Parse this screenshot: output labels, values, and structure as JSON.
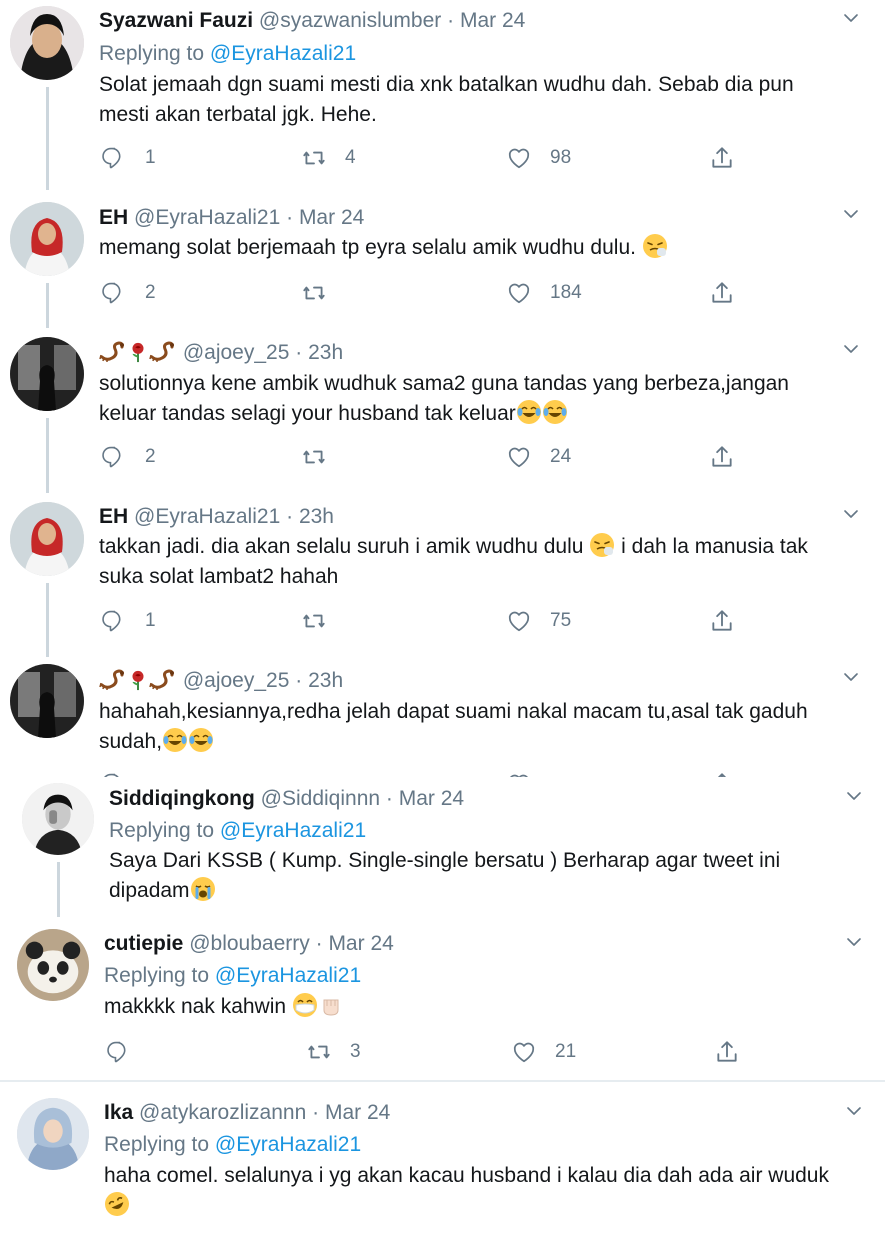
{
  "tweets": [
    {
      "name": "Syazwani Fauzi",
      "handle": "@syazwanislumber",
      "sep": "·",
      "time": "Mar 24",
      "replying_prefix": "Replying to",
      "replying_mention": "@EyraHazali21",
      "line1": "Solat jemaah dgn suami mesti dia xnk batalkan wudhu dah. Sebab dia pun",
      "line2": "mesti akan terbatal jgk. Hehe.",
      "reply_count": "1",
      "retweet_count": "4",
      "like_count": "98"
    },
    {
      "name": "EH",
      "handle": "@EyraHazali21",
      "sep": "·",
      "time": "Mar 24",
      "line1": "memang solat berjemaah tp eyra selalu amik wudhu dulu.",
      "reply_count": "2",
      "retweet_count": "",
      "like_count": "184"
    },
    {
      "handle": "@ajoey_25",
      "sep": "·",
      "time": "23h",
      "line1": "solutionnya kene ambik wudhuk sama2 guna tandas yang berbeza,jangan",
      "line2": "keluar tandas selagi your husband tak keluar",
      "reply_count": "2",
      "retweet_count": "",
      "like_count": "24"
    },
    {
      "name": "EH",
      "handle": "@EyraHazali21",
      "sep": "·",
      "time": "23h",
      "line1a": "takkan jadi. dia akan selalu suruh i amik wudhu dulu",
      "line1b": "i dah la manusia tak",
      "line2": "suka solat lambat2 hahah",
      "reply_count": "1",
      "retweet_count": "",
      "like_count": "75"
    },
    {
      "handle": "@ajoey_25",
      "sep": "·",
      "time": "23h",
      "line1": "hahahah,kesiannya,redha jelah dapat suami nakal macam tu,asal tak gaduh",
      "line2": "sudah,"
    },
    {
      "name": "Siddiqingkong",
      "handle": "@Siddiqinnn",
      "sep": "·",
      "time": "Mar 24",
      "replying_prefix": "Replying to",
      "replying_mention": "@EyraHazali21",
      "line1": "Saya Dari KSSB ( Kump. Single-single bersatu ) Berharap agar tweet ini",
      "line2": "dipadam"
    },
    {
      "name": "cutiepie",
      "handle": "@bloubaerry",
      "sep": "·",
      "time": "Mar 24",
      "replying_prefix": "Replying to",
      "replying_mention": "@EyraHazali21",
      "line1": "makkkk nak kahwin",
      "reply_count": "",
      "retweet_count": "3",
      "like_count": "21"
    },
    {
      "name": "Ika",
      "handle": "@atykarozlizannn",
      "sep": "·",
      "time": "Mar 24",
      "replying_prefix": "Replying to",
      "replying_mention": "@EyraHazali21",
      "line1": "haha comel. selalunya i yg akan kacau husband i kalau dia dah ada air wuduk"
    }
  ],
  "icons": {
    "reply": "reply-icon",
    "retweet": "retweet-icon",
    "like": "heart-icon",
    "share": "share-icon",
    "more": "chevron-down-icon"
  },
  "colors": {
    "text": "#14171a",
    "secondary": "#657786",
    "link": "#1b95e0",
    "line": "#ccd6dd"
  }
}
